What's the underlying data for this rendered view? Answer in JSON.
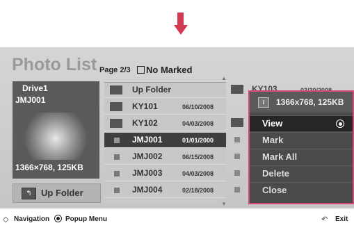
{
  "header": {
    "title": "Photo List",
    "page_info": "Page 2/3",
    "marked_text": "No Marked"
  },
  "preview": {
    "drive": "Drive1",
    "filename": "JMJ001",
    "resolution": "1366×768, 125KB",
    "up_folder": "Up Folder"
  },
  "files": [
    {
      "name": "Up Folder",
      "date": "",
      "type": "folder-up"
    },
    {
      "name": "KY101",
      "date": "06/10/2008",
      "type": "folder"
    },
    {
      "name": "KY102",
      "date": "04/03/2008",
      "type": "folder"
    },
    {
      "name": "JMJ001",
      "date": "01/01/2000",
      "type": "photo",
      "selected": true
    },
    {
      "name": "JMJ002",
      "date": "06/15/2008",
      "type": "photo"
    },
    {
      "name": "JMJ003",
      "date": "04/03/2008",
      "type": "photo"
    },
    {
      "name": "JMJ004",
      "date": "02/18/2008",
      "type": "photo"
    }
  ],
  "behind": {
    "name": "KY103",
    "date": "03/30/2008"
  },
  "popup": {
    "info": "1366x768, 125KB",
    "items": [
      "View",
      "Mark",
      "Mark All",
      "Delete",
      "Close"
    ],
    "highlighted": "View",
    "border_color": "#d24a78"
  },
  "footer": {
    "navigation": "Navigation",
    "popup_menu": "Popup Menu",
    "exit": "Exit"
  },
  "colors": {
    "arrow": "#d13a50"
  }
}
